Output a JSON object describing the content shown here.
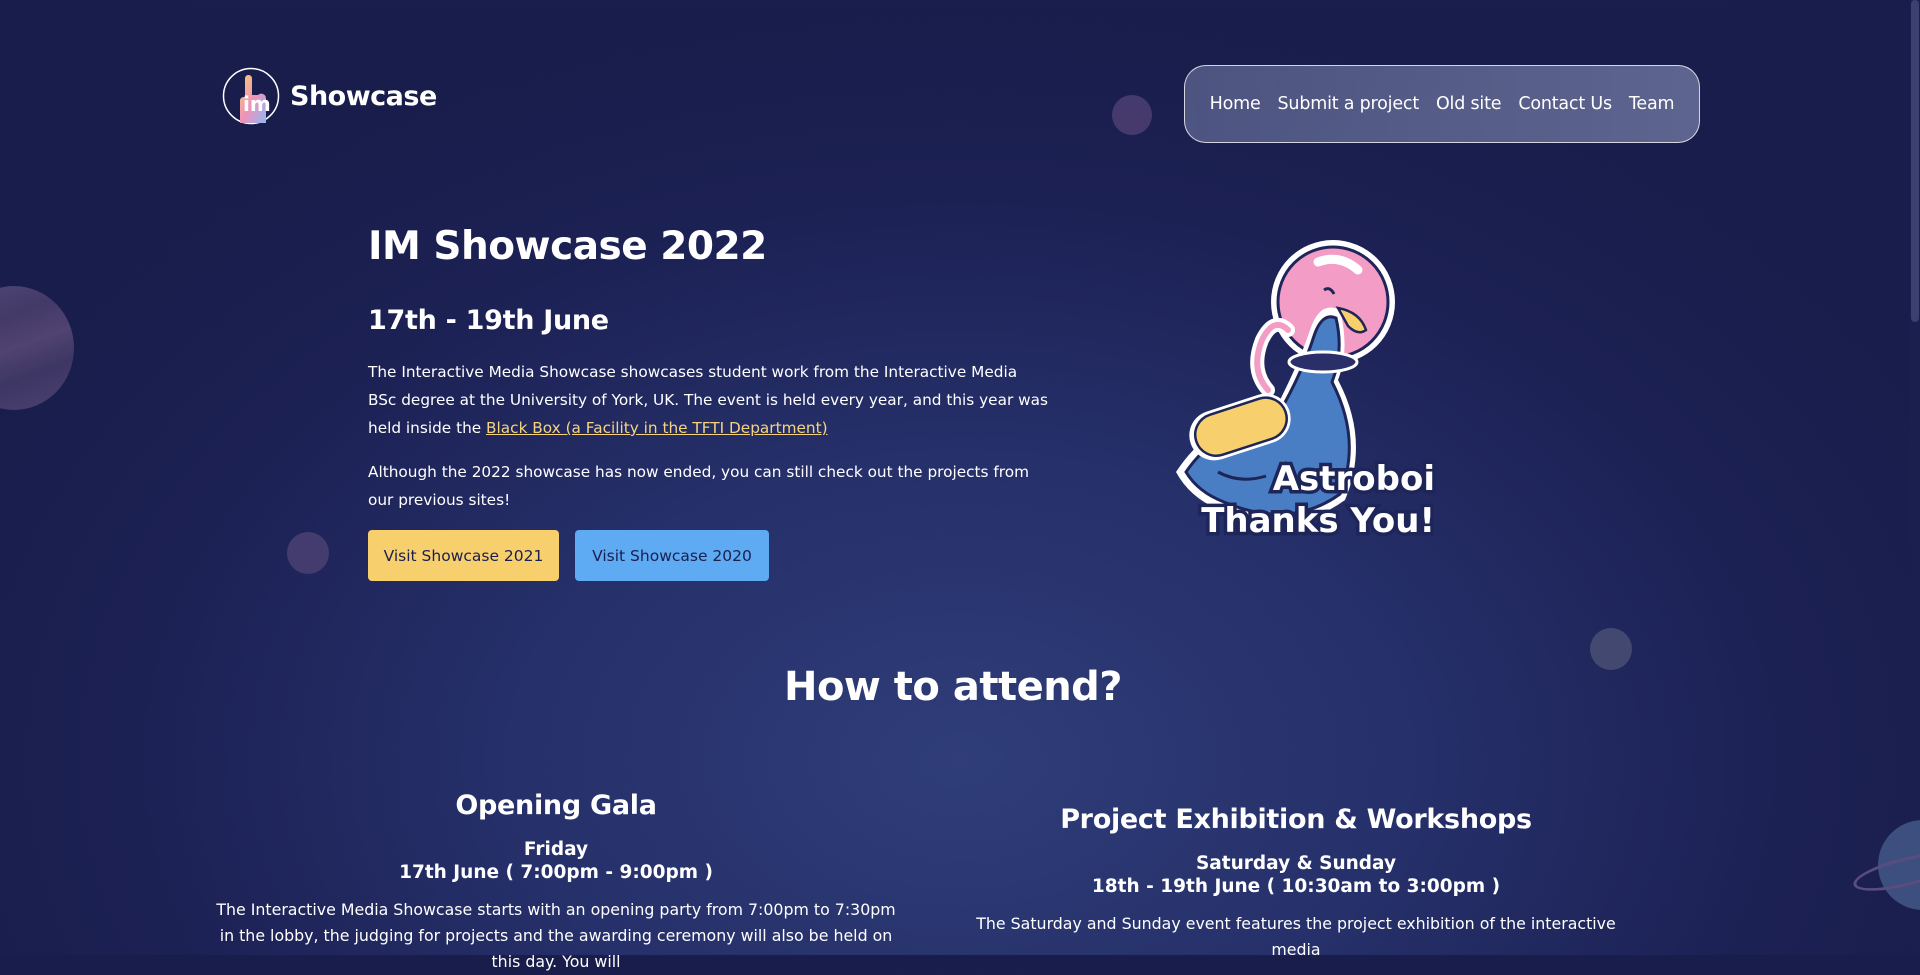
{
  "header": {
    "logo_text": "Showcase",
    "logo_mark_letters": "im"
  },
  "nav": {
    "items": [
      {
        "label": "Home"
      },
      {
        "label": "Submit a project"
      },
      {
        "label": "Old site"
      },
      {
        "label": "Contact Us"
      },
      {
        "label": "Team"
      }
    ]
  },
  "hero": {
    "title": "IM Showcase 2022",
    "dates": "17th - 19th June",
    "intro_text": "The Interactive Media Showcase showcases student work from the Interactive Media BSc degree at the University of York, UK. The event is held every year, and this year was held inside the ",
    "intro_link": "Black Box (a Facility in the TFTI Department)",
    "ended_text": "Although the 2022 showcase has now ended, you can still check out the projects from our previous sites!",
    "btn_2021": "Visit Showcase 2021",
    "btn_2020": "Visit Showcase 2020",
    "illustration_caption_line1": "Astroboi",
    "illustration_caption_line2": "Thanks You!"
  },
  "attend": {
    "title": "How to attend?",
    "gala": {
      "title": "Opening Gala",
      "day": "Friday",
      "dates": "17th June ( 7:00pm - 9:00pm )",
      "text": "The Interactive Media Showcase starts with an opening party from 7:00pm to 7:30pm in the lobby, the judging for projects and the awarding ceremony will also be held on this day. You will"
    },
    "exhibition": {
      "title": "Project Exhibition & Workshops",
      "day": "Saturday & Sunday",
      "dates": "18th - 19th June ( 10:30am to 3:00pm )",
      "text": "The Saturday and Sunday event features the project exhibition of the interactive media"
    }
  },
  "colors": {
    "background": "#1c2154",
    "accent_yellow": "#f7cf6c",
    "accent_blue": "#5eaaf3",
    "link": "#f6d47f"
  }
}
